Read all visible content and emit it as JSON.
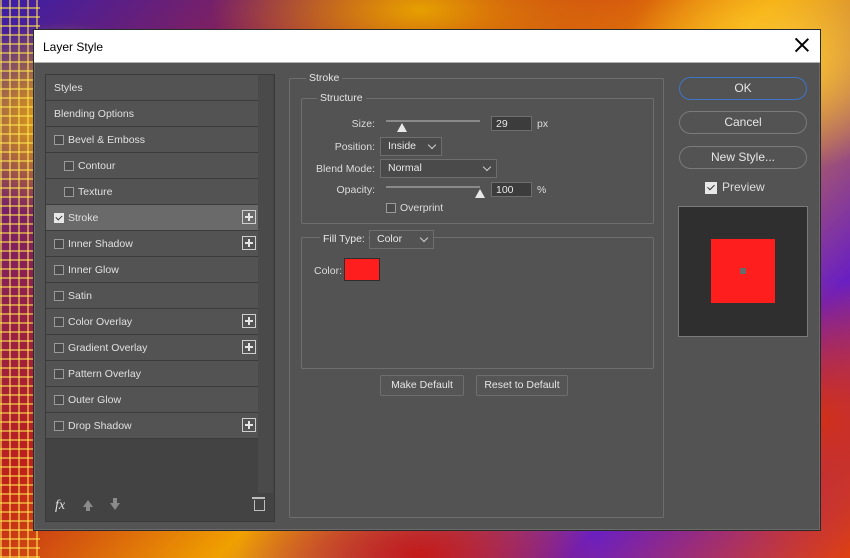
{
  "window": {
    "title": "Layer Style"
  },
  "styles_list": {
    "items": [
      {
        "label": "Styles",
        "checkbox": false,
        "indent": 0,
        "plus": false,
        "selected": false
      },
      {
        "label": "Blending Options",
        "checkbox": false,
        "indent": 0,
        "plus": false,
        "selected": false
      },
      {
        "label": "Bevel & Emboss",
        "checkbox": true,
        "indent": 0,
        "plus": false,
        "selected": false
      },
      {
        "label": "Contour",
        "checkbox": true,
        "indent": 1,
        "plus": false,
        "selected": false
      },
      {
        "label": "Texture",
        "checkbox": true,
        "indent": 1,
        "plus": false,
        "selected": false
      },
      {
        "label": "Stroke",
        "checkbox": true,
        "indent": 0,
        "plus": true,
        "selected": true
      },
      {
        "label": "Inner Shadow",
        "checkbox": true,
        "indent": 0,
        "plus": true,
        "selected": false
      },
      {
        "label": "Inner Glow",
        "checkbox": true,
        "indent": 0,
        "plus": false,
        "selected": false
      },
      {
        "label": "Satin",
        "checkbox": true,
        "indent": 0,
        "plus": false,
        "selected": false
      },
      {
        "label": "Color Overlay",
        "checkbox": true,
        "indent": 0,
        "plus": true,
        "selected": false
      },
      {
        "label": "Gradient Overlay",
        "checkbox": true,
        "indent": 0,
        "plus": true,
        "selected": false
      },
      {
        "label": "Pattern Overlay",
        "checkbox": true,
        "indent": 0,
        "plus": false,
        "selected": false
      },
      {
        "label": "Outer Glow",
        "checkbox": true,
        "indent": 0,
        "plus": false,
        "selected": false
      },
      {
        "label": "Drop Shadow",
        "checkbox": true,
        "indent": 0,
        "plus": true,
        "selected": false
      }
    ],
    "footer": {
      "fx_label": "fx"
    }
  },
  "stroke": {
    "group_title": "Stroke",
    "structure": {
      "title": "Structure",
      "size_label": "Size:",
      "size_value": "29",
      "size_unit": "px",
      "size_slider_fraction": 0.17,
      "position_label": "Position:",
      "position_value": "Inside",
      "blend_mode_label": "Blend Mode:",
      "blend_mode_value": "Normal",
      "opacity_label": "Opacity:",
      "opacity_value": "100",
      "opacity_unit": "%",
      "opacity_slider_fraction": 1.0,
      "overprint_label": "Overprint",
      "overprint_checked": false
    },
    "fill": {
      "fill_type_label": "Fill Type:",
      "fill_type_value": "Color",
      "color_label": "Color:",
      "color_hex": "#ff1e1e"
    },
    "make_default_label": "Make Default",
    "reset_default_label": "Reset to Default"
  },
  "actions": {
    "ok_label": "OK",
    "cancel_label": "Cancel",
    "new_style_label": "New Style...",
    "preview_label": "Preview",
    "preview_checked": true
  },
  "colors": {
    "accent_blue": "#3f74c7",
    "stroke_color": "#ff1e1e"
  }
}
